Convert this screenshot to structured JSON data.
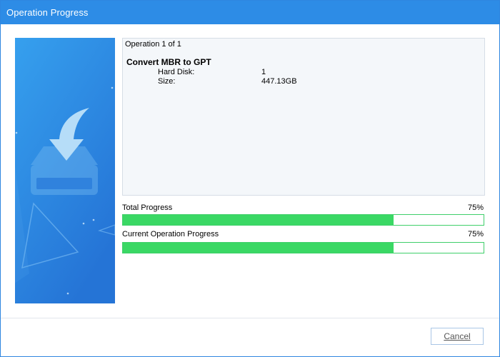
{
  "window": {
    "title": "Operation Progress"
  },
  "operation": {
    "header": "Operation 1 of 1",
    "name": "Convert MBR to GPT",
    "details": [
      {
        "label": "Hard Disk:",
        "value": "1"
      },
      {
        "label": "Size:",
        "value": "447.13GB"
      }
    ]
  },
  "progress": {
    "total": {
      "label": "Total Progress",
      "percent_text": "75%",
      "value": 0.75
    },
    "current": {
      "label": "Current Operation Progress",
      "percent_text": "75%",
      "value": 0.75
    }
  },
  "footer": {
    "cancel_label": "Cancel"
  },
  "icons": {
    "side_illustration": "disk-download-icon"
  },
  "colors": {
    "titlebar": "#2d8ce6",
    "progress_fill": "#3ad864",
    "progress_border": "#3fcf6a",
    "side_panel": "#2a86e0"
  }
}
